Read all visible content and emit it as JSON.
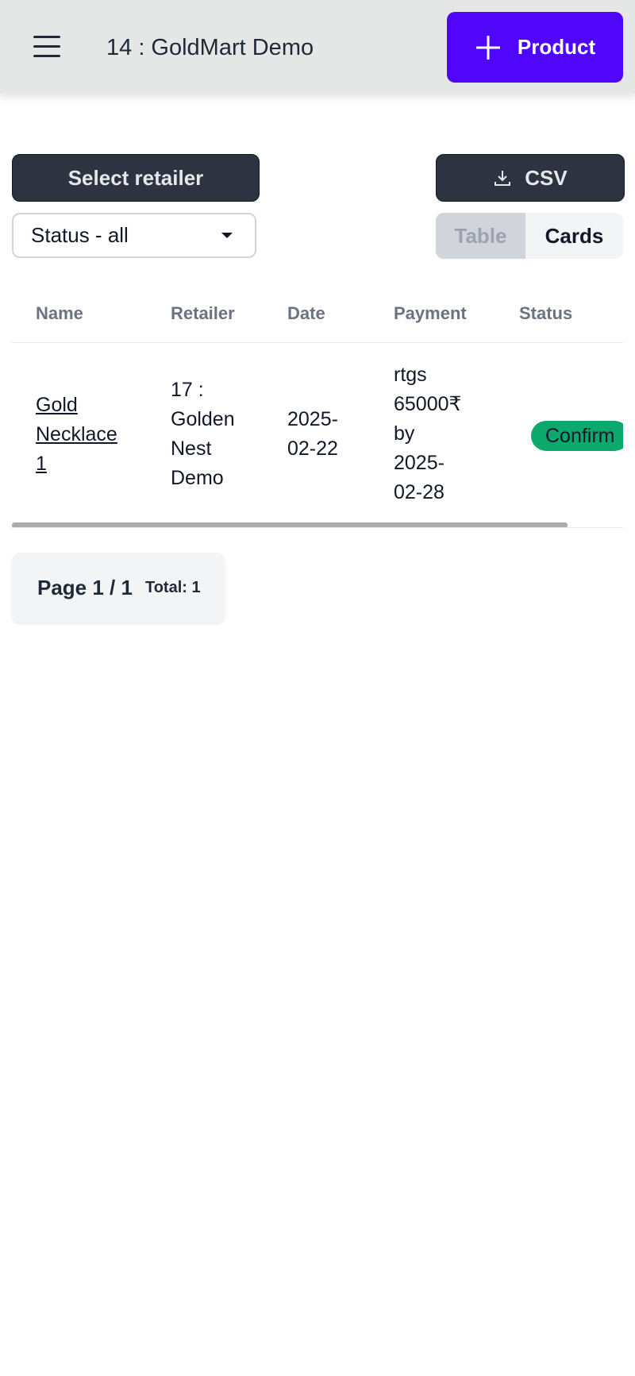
{
  "header": {
    "title": "14 : GoldMart Demo",
    "add_product_label": "Product"
  },
  "toolbar": {
    "select_retailer_label": "Select retailer",
    "csv_label": "CSV",
    "status_filter_value": "Status - all",
    "view_options": [
      "Table",
      "Cards"
    ],
    "active_view": "Table"
  },
  "table": {
    "columns": [
      "Name",
      "Retailer",
      "Date",
      "Payment",
      "Status"
    ],
    "rows": [
      {
        "name": [
          "Gold",
          "Necklace",
          "1"
        ],
        "retailer": [
          "17 :",
          "Golden",
          "Nest",
          "Demo"
        ],
        "date": [
          "2025-",
          "02-22"
        ],
        "payment": [
          "rtgs",
          "65000₹",
          "by",
          "2025-",
          "02-28"
        ],
        "status": "Confirm",
        "status_color": "#0da86c"
      }
    ]
  },
  "pagination": {
    "page_label": "Page 1 / 1",
    "total_label": "Total: 1"
  },
  "colors": {
    "accent": "#4f06fb",
    "dark_button": "#2d3340",
    "header_bg": "#e5e7e7"
  }
}
